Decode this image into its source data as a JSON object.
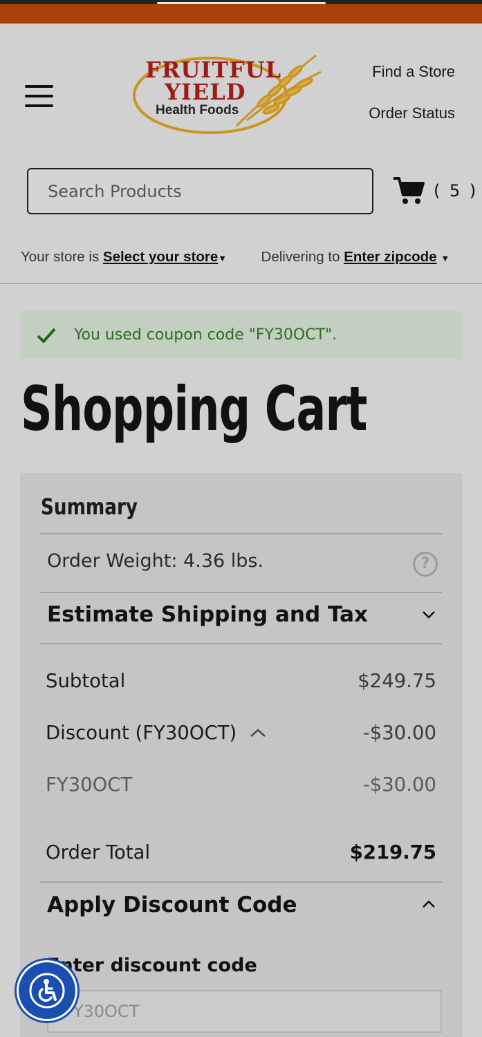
{
  "header": {
    "logo": {
      "line1": "FRUITFUL",
      "line2": "YIELD",
      "line3": "Health Foods"
    },
    "links": {
      "find_store": "Find a Store",
      "order_status": "Order Status"
    },
    "search": {
      "placeholder": "Search Products"
    },
    "cart": {
      "count": "( 5 )"
    },
    "store": {
      "prefix": "Your store is",
      "select_label": "Select your store",
      "delivery_prefix": "Delivering to",
      "zip_label": "Enter zipcode"
    }
  },
  "notice": {
    "message": "You used coupon code \"FY30OCT\"."
  },
  "page": {
    "title": "Shopping Cart"
  },
  "summary": {
    "heading": "Summary",
    "order_weight": "Order Weight: 4.36 lbs.",
    "estimate_label": "Estimate Shipping and Tax",
    "subtotal_label": "Subtotal",
    "subtotal_value": "$249.75",
    "discount_label": "Discount (FY30OCT)",
    "discount_value": "-$30.00",
    "coupon_code": "FY30OCT",
    "coupon_value": "-$30.00",
    "total_label": "Order Total",
    "total_value": "$219.75",
    "apply_label": "Apply Discount Code",
    "enter_label": "Enter discount code",
    "code_value": "FY30OCT"
  },
  "colors": {
    "topbar": "#a8410a",
    "notice_bg": "#c2cfc1",
    "notice_text": "#2f6b23",
    "logo_red": "#9c1a18",
    "accessibility": "#1a4fb0"
  }
}
